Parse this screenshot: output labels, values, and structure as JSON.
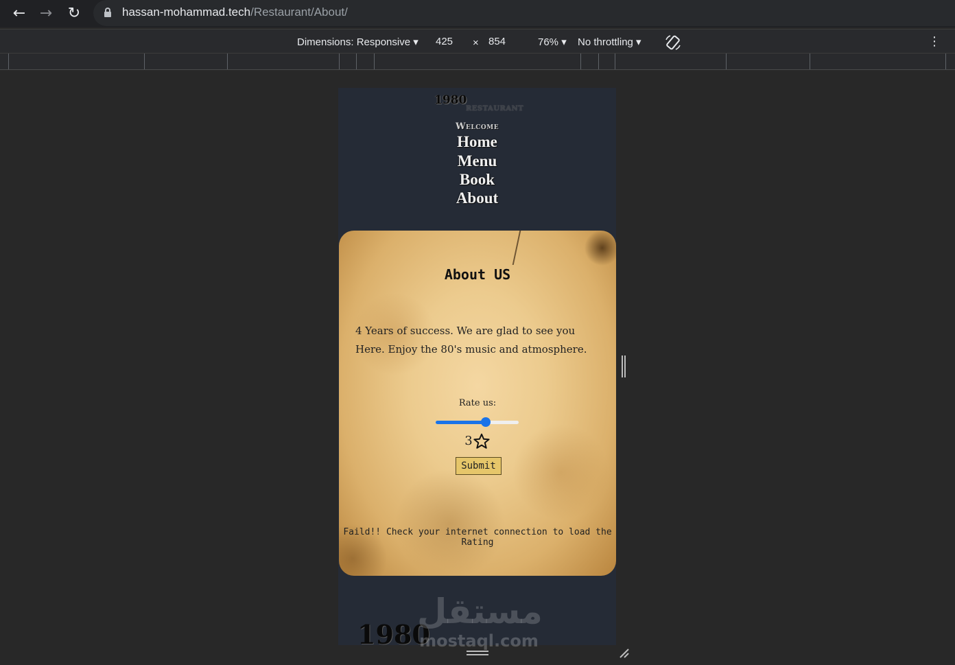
{
  "browser": {
    "url_host": "hassan-mohammad.tech",
    "url_path": "/Restaurant/About/"
  },
  "device_toolbar": {
    "dimensions_label": "Dimensions: Responsive ▾",
    "width": "425",
    "times": "×",
    "height": "854",
    "zoom": "76% ▾",
    "throttling": "No throttling ▾",
    "more": "⋮"
  },
  "site": {
    "logo_year": "1980",
    "logo_sub": "RESTAURANT",
    "nav": {
      "welcome": "Welcome",
      "home": "Home",
      "menu": "Menu",
      "book": "Book",
      "about": "About"
    },
    "about": {
      "title": "About US",
      "text": "4 Years of success. We are glad to see you Here. Enjoy the 80's music and atmosphere.",
      "rate_label": "Rate us:",
      "rating_value": "3",
      "rating_fraction": 0.6,
      "submit_label": "Submit",
      "fail_message": "Faild!! Check your internet connection to load the Rating"
    },
    "footer_logo": "1980"
  },
  "watermark": {
    "arabic": "مستقل",
    "latin": "mostaql.com"
  },
  "colors": {
    "accent": "#1a73e8",
    "viewport_bg": "#252b36",
    "button_bg": "#e6c66a"
  }
}
